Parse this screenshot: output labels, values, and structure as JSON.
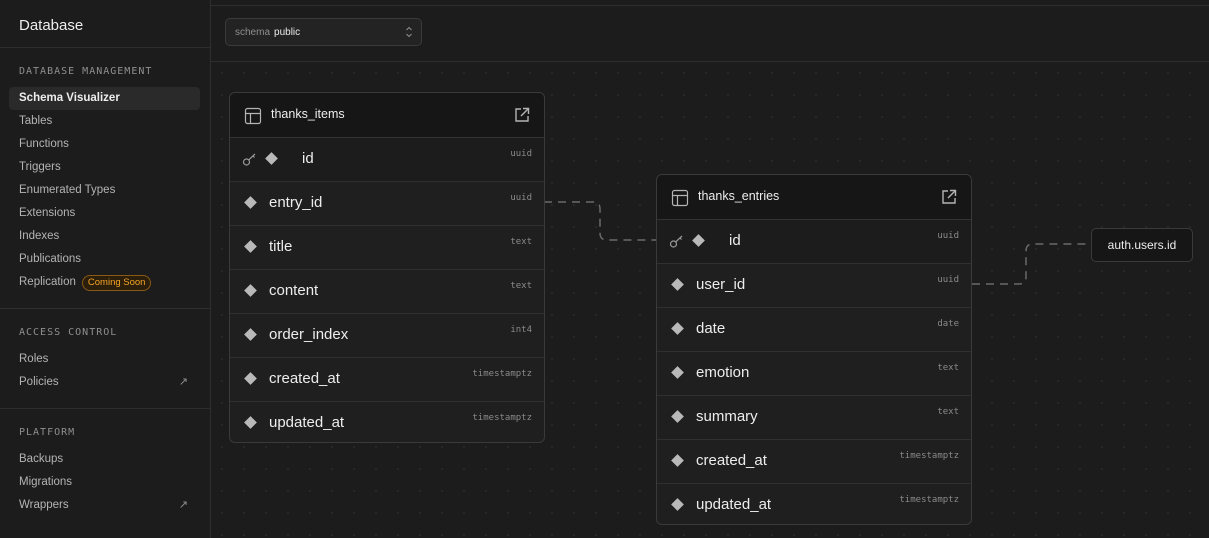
{
  "sidebar": {
    "title": "Database",
    "sections": [
      {
        "title": "DATABASE MANAGEMENT",
        "items": [
          {
            "label": "Schema Visualizer",
            "active": true
          },
          {
            "label": "Tables"
          },
          {
            "label": "Functions"
          },
          {
            "label": "Triggers"
          },
          {
            "label": "Enumerated Types"
          },
          {
            "label": "Extensions"
          },
          {
            "label": "Indexes"
          },
          {
            "label": "Publications"
          },
          {
            "label": "Replication",
            "badge": "Coming Soon"
          }
        ]
      },
      {
        "title": "ACCESS CONTROL",
        "items": [
          {
            "label": "Roles"
          },
          {
            "label": "Policies",
            "external": true
          }
        ]
      },
      {
        "title": "PLATFORM",
        "items": [
          {
            "label": "Backups"
          },
          {
            "label": "Migrations"
          },
          {
            "label": "Wrappers",
            "external": true
          }
        ]
      }
    ]
  },
  "toolbar": {
    "schema_label": "schema",
    "schema_value": "public"
  },
  "tables": [
    {
      "name": "thanks_items",
      "columns": [
        {
          "name": "id",
          "type": "uuid",
          "primary": true
        },
        {
          "name": "entry_id",
          "type": "uuid"
        },
        {
          "name": "title",
          "type": "text"
        },
        {
          "name": "content",
          "type": "text"
        },
        {
          "name": "order_index",
          "type": "int4"
        },
        {
          "name": "created_at",
          "type": "timestamptz"
        },
        {
          "name": "updated_at",
          "type": "timestamptz"
        }
      ]
    },
    {
      "name": "thanks_entries",
      "columns": [
        {
          "name": "id",
          "type": "uuid",
          "primary": true
        },
        {
          "name": "user_id",
          "type": "uuid"
        },
        {
          "name": "date",
          "type": "date"
        },
        {
          "name": "emotion",
          "type": "text"
        },
        {
          "name": "summary",
          "type": "text"
        },
        {
          "name": "created_at",
          "type": "timestamptz"
        },
        {
          "name": "updated_at",
          "type": "timestamptz"
        }
      ]
    }
  ],
  "reference": {
    "label": "auth.users.id"
  },
  "icons": {
    "table": "table-icon",
    "open": "external-link-icon",
    "key": "key-icon",
    "column": "diamond-icon"
  },
  "colors": {
    "background": "#1c1c1c",
    "badge": "#f5a524"
  }
}
